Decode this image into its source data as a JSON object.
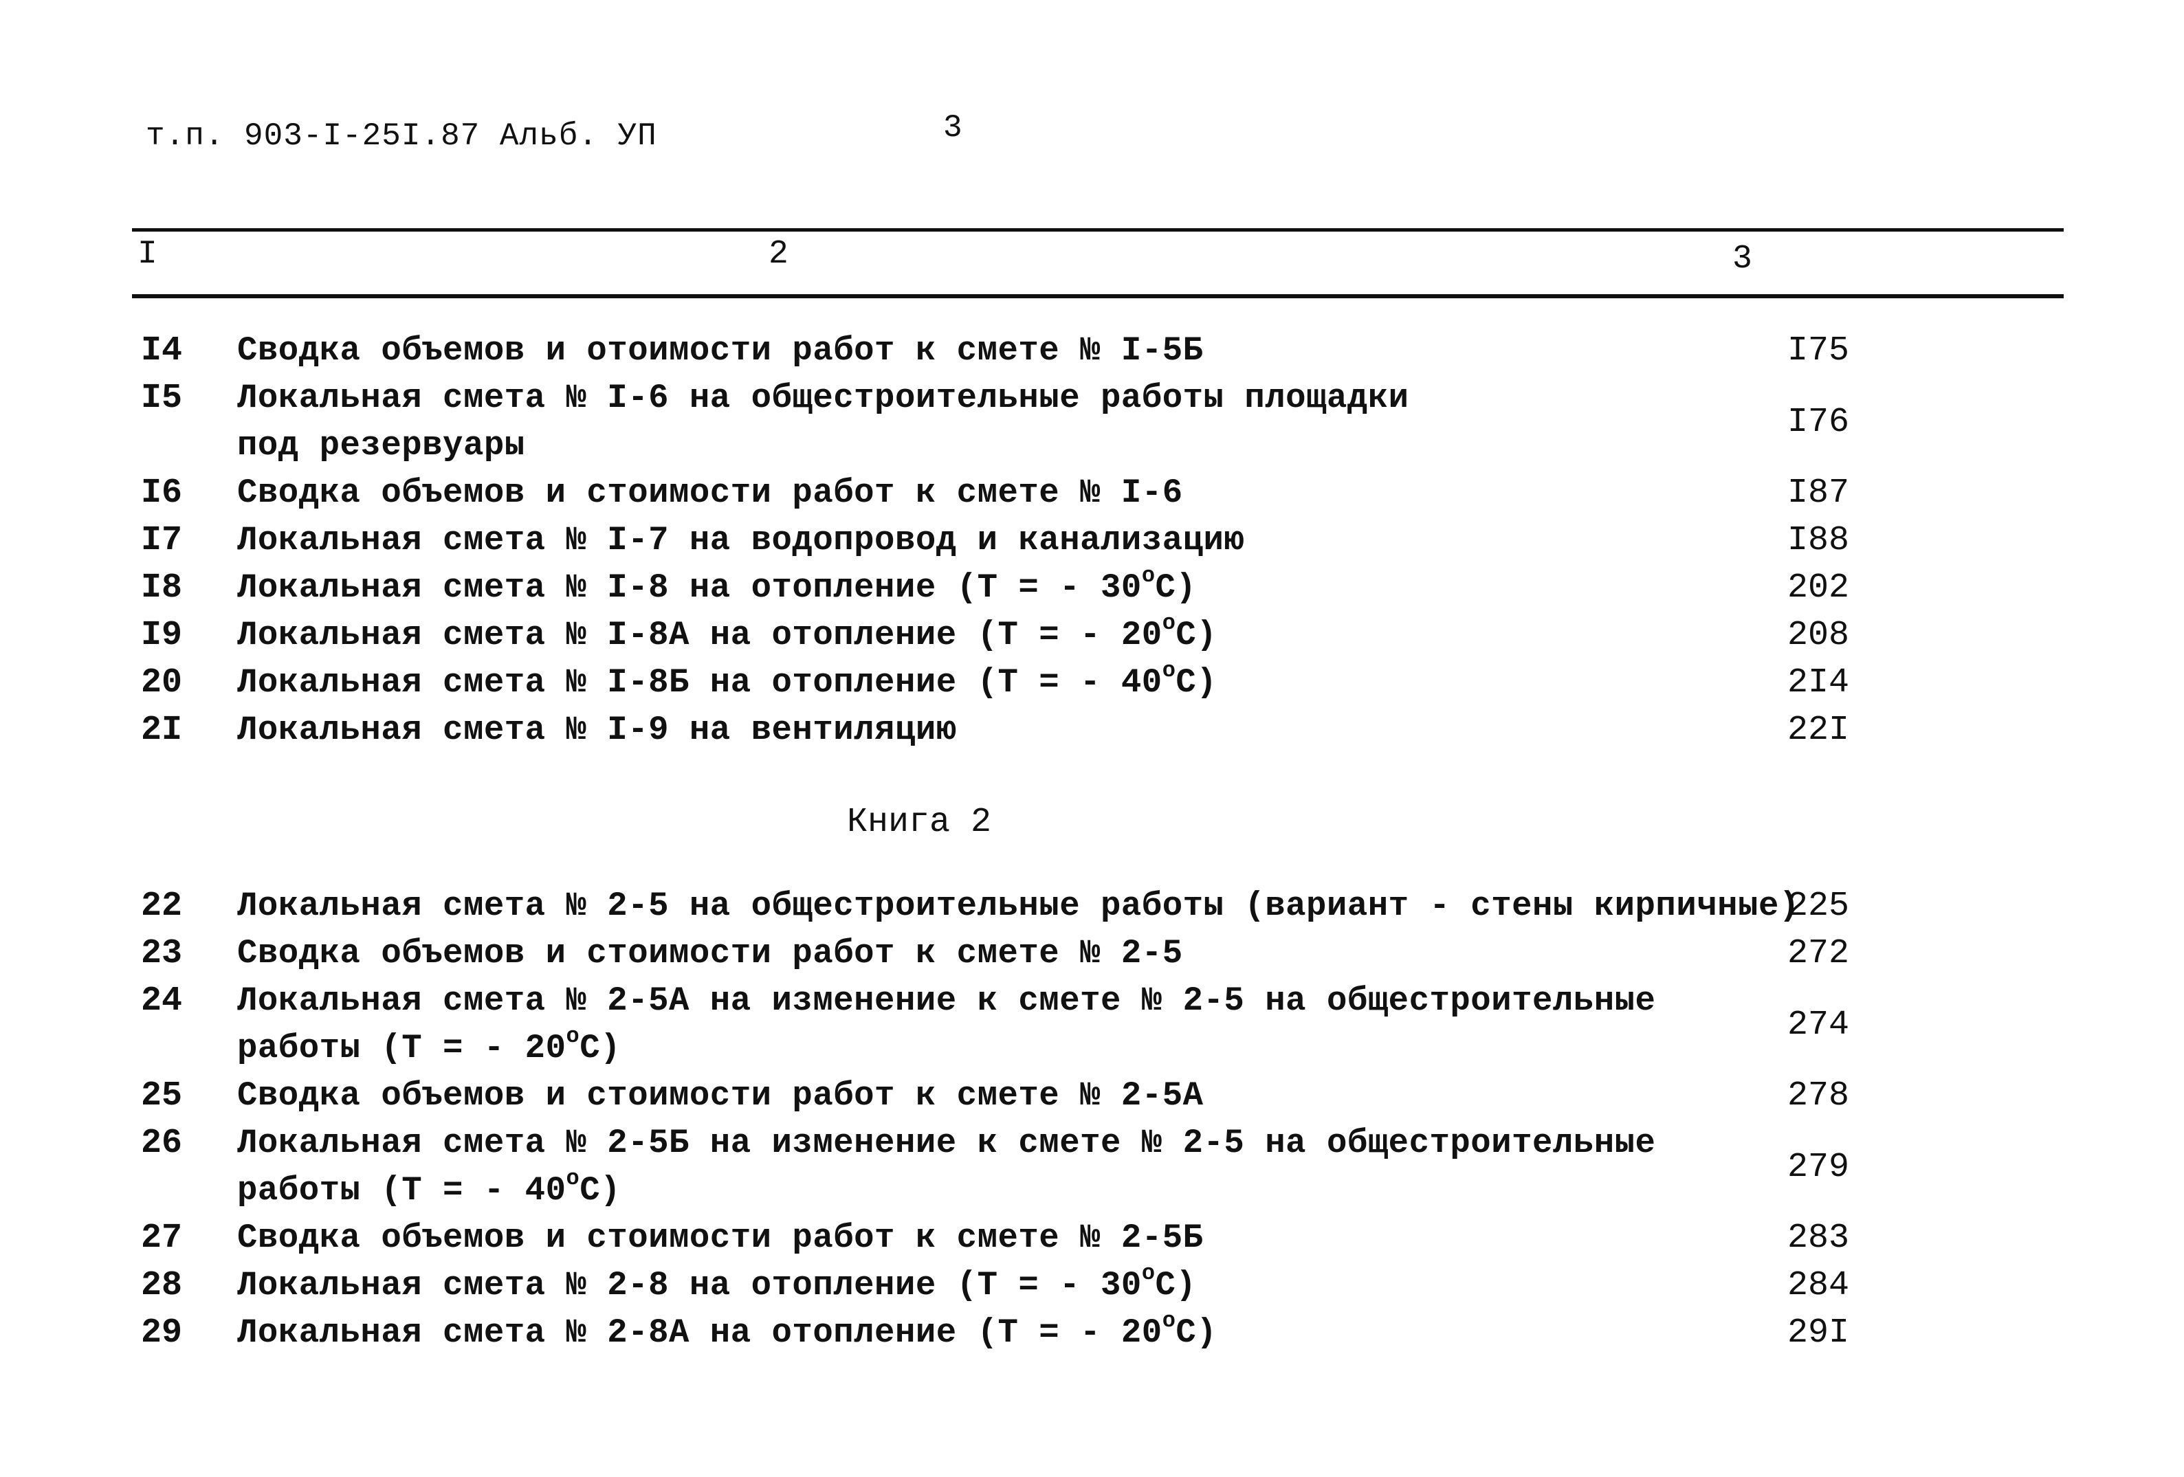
{
  "header": {
    "doc_code": "т.п. 903-I-25I.87 Альб. УП",
    "page_number": "3"
  },
  "columns": [
    "I",
    "2",
    "3"
  ],
  "book1_rows": [
    {
      "num": "I4",
      "lines": [
        "Сводка объемов и отоимости работ к смете № I-5Б"
      ],
      "page": "I75"
    },
    {
      "num": "I5",
      "lines": [
        "Локальная смета № I-6 на общестроительные работы площадки",
        "под резервуары"
      ],
      "page": "I76"
    },
    {
      "num": "I6",
      "lines": [
        "Сводка объемов и стоимости работ к смете № I-6"
      ],
      "page": "I87"
    },
    {
      "num": "I7",
      "lines": [
        "Локальная смета № I-7 на водопровод и канализацию"
      ],
      "page": "I88"
    },
    {
      "num": "I8",
      "lines": [
        "Локальная смета № I-8 на отопление (Т = - 30°С)"
      ],
      "page": "202"
    },
    {
      "num": "I9",
      "lines": [
        "Локальная смета № I-8А на отопление (Т = - 20°С)"
      ],
      "page": "208"
    },
    {
      "num": "20",
      "lines": [
        "Локальная смета № I-8Б на отопление (Т = - 40°С)"
      ],
      "page": "2I4"
    },
    {
      "num": "2I",
      "lines": [
        "Локальная смета № I-9 на вентиляцию"
      ],
      "page": "22I"
    }
  ],
  "book2_title": "Книга 2",
  "book2_rows": [
    {
      "num": "22",
      "lines": [
        "Локальная смета № 2-5 на общестроительные работы (вариант - стены кирпичные)"
      ],
      "page": "225"
    },
    {
      "num": "23",
      "lines": [
        "Сводка объемов и стоимости работ к смете № 2-5"
      ],
      "page": "272"
    },
    {
      "num": "24",
      "lines": [
        "Локальная смета № 2-5А на изменение к смете № 2-5 на общестроительные",
        "работы (Т = - 20°С)"
      ],
      "page": "274"
    },
    {
      "num": "25",
      "lines": [
        "Сводка объемов и стоимости работ к смете № 2-5А"
      ],
      "page": "278"
    },
    {
      "num": "26",
      "lines": [
        "Локальная смета № 2-5Б на изменение к смете № 2-5 на общестроительные",
        "работы (Т = - 40°С)"
      ],
      "page": "279"
    },
    {
      "num": "27",
      "lines": [
        "Сводка объемов и стоимости работ к смете № 2-5Б"
      ],
      "page": "283"
    },
    {
      "num": "28",
      "lines": [
        "Локальная смета № 2-8  на отопление (Т = - 30°С)"
      ],
      "page": "284"
    },
    {
      "num": "29",
      "lines": [
        "Локальная смета № 2-8А на отопление (Т = - 20°С)"
      ],
      "page": "29I"
    }
  ]
}
